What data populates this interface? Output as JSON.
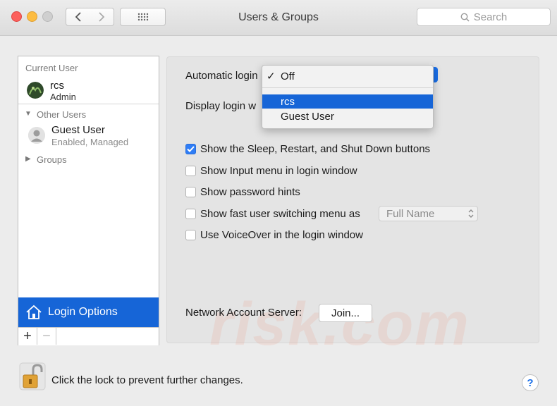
{
  "window": {
    "title": "Users & Groups"
  },
  "toolbar": {
    "search_placeholder": "Search"
  },
  "sidebar": {
    "current_user_label": "Current User",
    "current_user": {
      "name": "rcs",
      "role": "Admin"
    },
    "other_users_label": "Other Users",
    "other_users": [
      {
        "name": "Guest User",
        "status": "Enabled, Managed"
      }
    ],
    "groups_label": "Groups",
    "login_options_label": "Login Options",
    "add_label": "+",
    "remove_label": "−"
  },
  "main": {
    "automatic_login_label": "Automatic login",
    "display_login_label": "Display login w",
    "dropdown": {
      "items": [
        {
          "label": "Off",
          "checked": true
        },
        {
          "label": "rcs",
          "selected": true
        },
        {
          "label": "Guest User"
        }
      ]
    },
    "checkboxes": [
      {
        "label": "Show the Sleep, Restart, and Shut Down buttons",
        "checked": true
      },
      {
        "label": "Show Input menu in login window",
        "checked": false
      },
      {
        "label": "Show password hints",
        "checked": false
      },
      {
        "label": "Show fast user switching menu as",
        "checked": false
      },
      {
        "label": "Use VoiceOver in the login window",
        "checked": false
      }
    ],
    "fast_switch_value": "Full Name",
    "network_server_label": "Network Account Server:",
    "join_label": "Join..."
  },
  "footer": {
    "lock_text": "Click the lock to prevent further changes.",
    "help_label": "?"
  },
  "watermark": {
    "text": "risk.com"
  },
  "colors": {
    "accent": "#1665d7",
    "checkbox_on": "#2f7df6"
  }
}
